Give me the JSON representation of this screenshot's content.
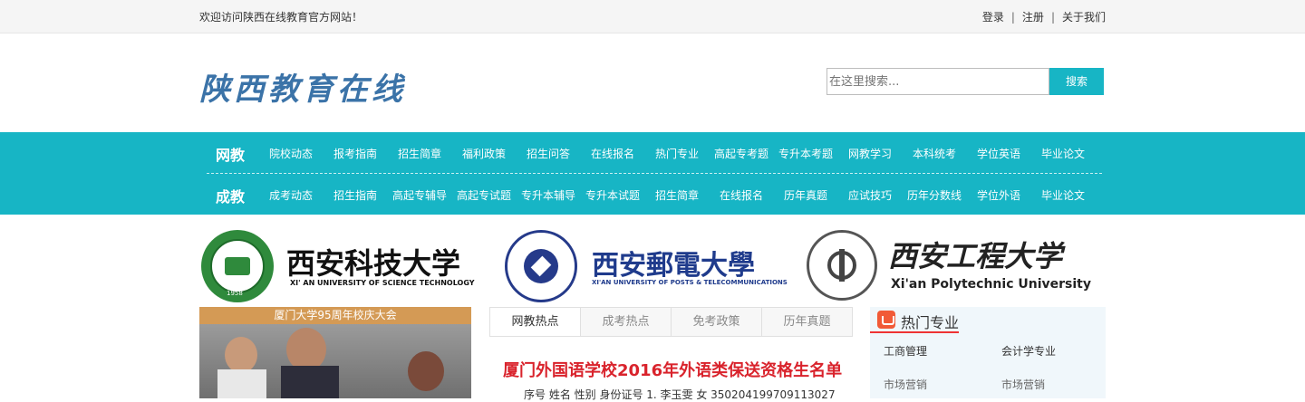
{
  "topbar": {
    "welcome": "欢迎访问陕西在线教育官方网站！",
    "links": [
      "登录",
      "注册",
      "关于我们"
    ]
  },
  "header": {
    "logo_text": "陕西教育在线",
    "search_placeholder": "在这里搜索...",
    "search_button": "搜索"
  },
  "nav": {
    "row1": {
      "category": "网教",
      "items": [
        "院校动态",
        "报考指南",
        "招生简章",
        "福利政策",
        "招生问答",
        "在线报名",
        "热门专业",
        "高起专考题",
        "专升本考题",
        "网教学习",
        "本科统考",
        "学位英语",
        "毕业论文"
      ]
    },
    "row2": {
      "category": "成教",
      "items": [
        "成考动态",
        "招生指南",
        "高起专辅导",
        "高起专试题",
        "专升本辅导",
        "专升本试题",
        "招生简章",
        "在线报名",
        "历年真题",
        "应试技巧",
        "历年分数线",
        "学位外语",
        "毕业论文"
      ]
    }
  },
  "universities": [
    {
      "name_cn": "西安科技大学",
      "name_en": "XI' AN UNIVERSITY OF SCIENCE TECHNOLOGY",
      "seal_text": "1958"
    },
    {
      "name_cn": "西安郵電大學",
      "name_en": "XI'AN UNIVERSITY OF POSTS & TELECOMMUNICATIONS"
    },
    {
      "name_cn": "西安工程大学",
      "name_en": "Xi'an Polytechnic University"
    }
  ],
  "feature": {
    "caption": "厦门大学95周年校庆大会"
  },
  "news": {
    "tabs": [
      "网教热点",
      "成考热点",
      "免考政策",
      "历年真题"
    ],
    "headline": "厦门外国语学校2016年外语类保送资格生名单",
    "snippet": "序号 姓名 性别 身份证号 1. 李玉雯 女 350204199709113027"
  },
  "hot_majors": {
    "title": "热门专业",
    "items": [
      "工商管理",
      "会计学专业",
      "市场营销",
      "市场营销"
    ]
  },
  "colors": {
    "accent": "#17b5c5",
    "headline": "#d9232c",
    "logo": "#3b73a8"
  }
}
